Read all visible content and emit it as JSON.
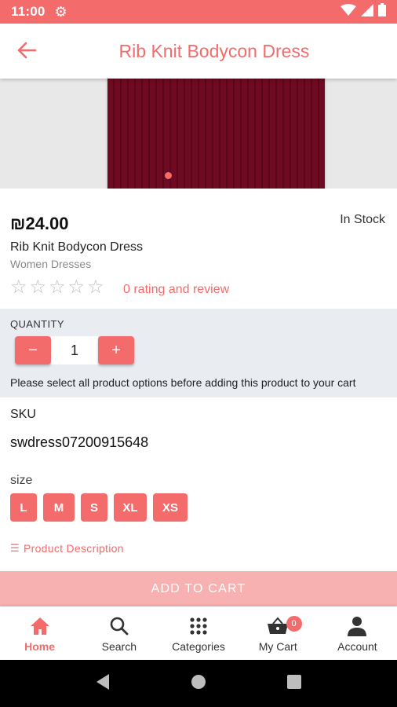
{
  "status_bar": {
    "time": "11:00"
  },
  "header": {
    "title": "Rib Knit Bodycon Dress"
  },
  "product": {
    "price": "₪24.00",
    "stock_status": "In Stock",
    "name": "Rib Knit Bodycon Dress",
    "category": "Women Dresses",
    "rating_text": "0 rating and review",
    "image_dots": 1
  },
  "quantity": {
    "label": "QUANTITY",
    "minus_label": "−",
    "value": "1",
    "plus_label": "+",
    "note": "Please select all product options before adding this product to your cart"
  },
  "sku": {
    "label": "SKU",
    "value": "swdress07200915648"
  },
  "size": {
    "label": "size",
    "options": [
      "L",
      "M",
      "S",
      "XL",
      "XS"
    ]
  },
  "description": {
    "link_text": "Product Description"
  },
  "add_to_cart": {
    "label": "ADD TO CART"
  },
  "bottom_nav": {
    "items": [
      {
        "label": "Home",
        "icon": "home-icon",
        "active": true
      },
      {
        "label": "Search",
        "icon": "search-icon",
        "active": false
      },
      {
        "label": "Categories",
        "icon": "grid-icon",
        "active": false
      },
      {
        "label": "My Cart",
        "icon": "basket-icon",
        "active": false
      },
      {
        "label": "Account",
        "icon": "person-icon",
        "active": false
      }
    ],
    "cart_badge": "0"
  },
  "colors": {
    "accent": "#f36b6b",
    "accent_light": "#f7b1b1",
    "section_bg": "#e9ecf1"
  }
}
